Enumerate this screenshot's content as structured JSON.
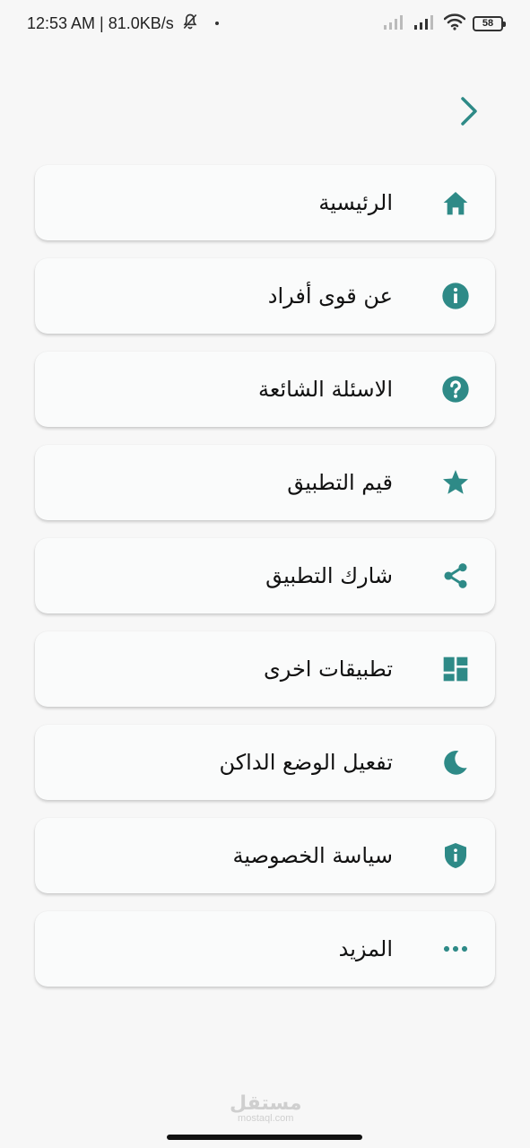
{
  "status_bar": {
    "time_speed": "12:53 AM | 81.0KB/s",
    "battery": "58"
  },
  "colors": {
    "accent": "#2e8a87",
    "background": "#f7f7f7",
    "card": "#fafbfb"
  },
  "back_icon": "chevron-right-icon",
  "menu": [
    {
      "label": "الرئيسية",
      "icon": "home-icon"
    },
    {
      "label": "عن قوى أفراد",
      "icon": "info-icon"
    },
    {
      "label": "الاسئلة الشائعة",
      "icon": "help-icon"
    },
    {
      "label": "قيم التطبيق",
      "icon": "star-icon"
    },
    {
      "label": "شارك التطبيق",
      "icon": "share-icon"
    },
    {
      "label": "تطبيقات اخرى",
      "icon": "dashboard-icon"
    },
    {
      "label": "تفعيل الوضع الداكن",
      "icon": "moon-icon"
    },
    {
      "label": "سياسة الخصوصية",
      "icon": "shield-info-icon"
    },
    {
      "label": "المزيد",
      "icon": "more-horizontal-icon"
    }
  ],
  "watermark": {
    "arabic": "مستقل",
    "latin": "mostaql.com"
  }
}
